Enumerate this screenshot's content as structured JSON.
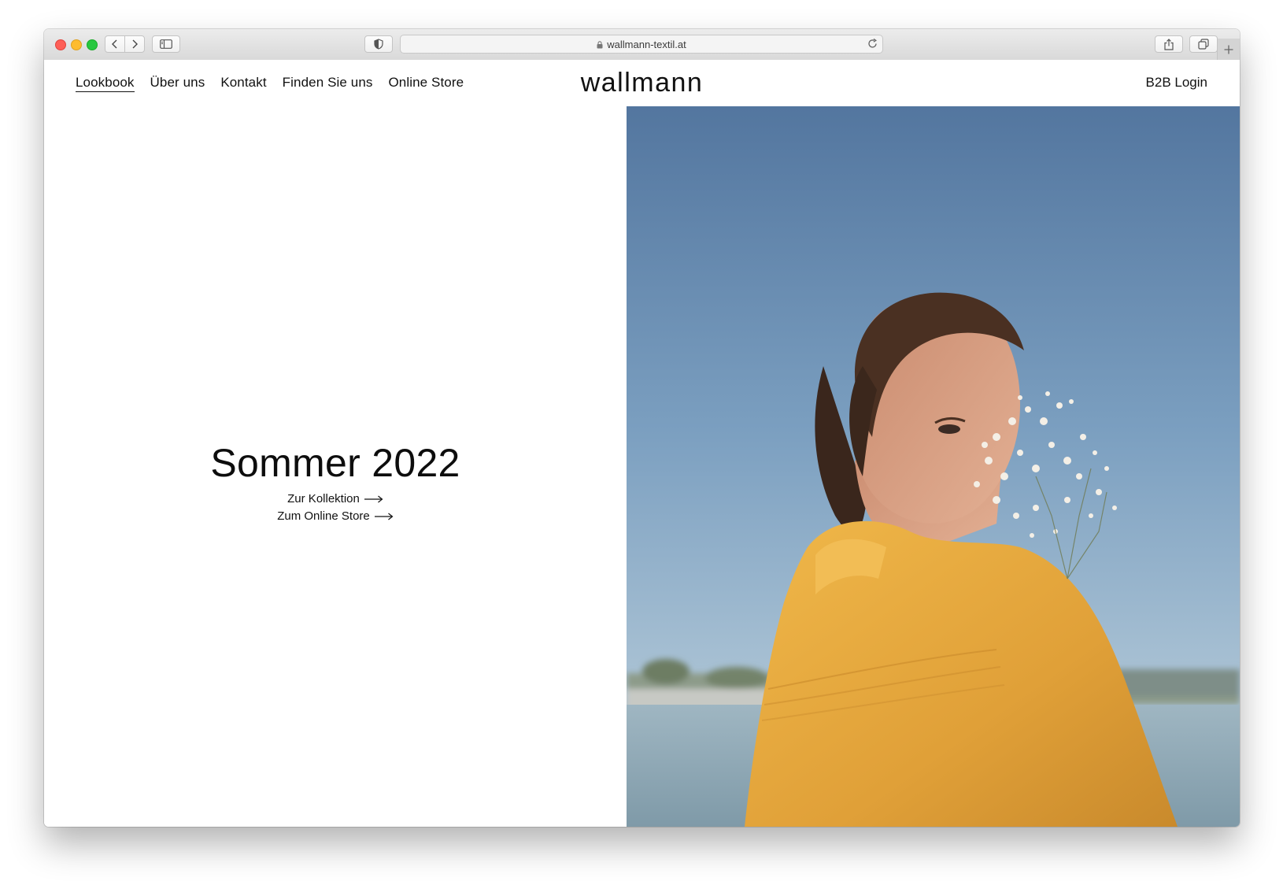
{
  "browser": {
    "url": "wallmann-textil.at"
  },
  "nav": {
    "items": [
      "Lookbook",
      "Über uns",
      "Kontakt",
      "Finden Sie uns",
      "Online Store"
    ],
    "active": "Lookbook"
  },
  "brand": {
    "logo": "wallmann"
  },
  "header": {
    "b2b_login": "B2B Login"
  },
  "hero": {
    "title": "Sommer 2022",
    "link_collection": "Zur Kollektion",
    "link_store": "Zum Online Store"
  },
  "colors": {
    "sky": "#6f95b8",
    "blouse": "#e1a43b",
    "text": "#111111"
  }
}
